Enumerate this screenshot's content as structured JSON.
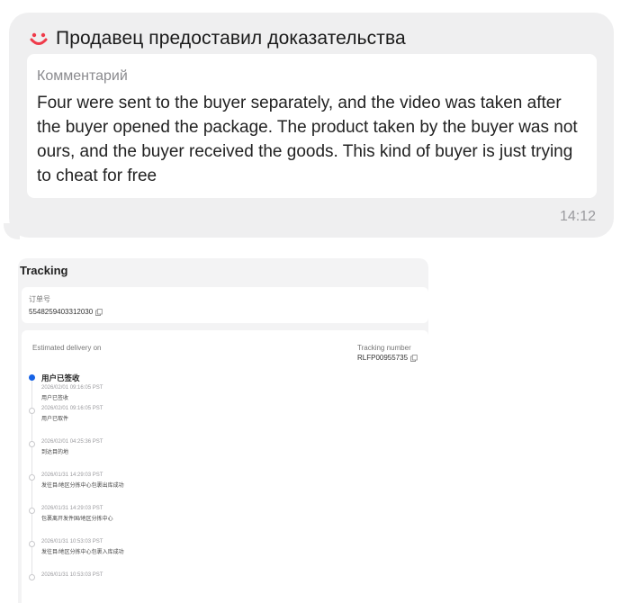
{
  "chat": {
    "title": "Продавец предоставил доказательства",
    "comment_label": "Комментарий",
    "comment_text": "Four were sent to the buyer separately, and the video was taken after the buyer opened the package. The product taken by the buyer was not ours, and the buyer received the goods. This kind of buyer is just trying to cheat for free",
    "time": "14:12",
    "accent_color": "#ef3b4a"
  },
  "tracking": {
    "title": "Tracking",
    "order_label": "订单号",
    "order_number": "5548259403312030",
    "estimated_delivery_label": "Estimated delivery on",
    "tracking_number_label": "Tracking number",
    "tracking_number": "RLFP00955735",
    "active_color": "#1763e6",
    "events": [
      {
        "headline": "用户已签收",
        "time": "2026/02/01 09:16:05 PST",
        "desc": "用户已签收"
      },
      {
        "headline": "",
        "time": "2026/02/01 09:16:05 PST",
        "desc": "用户已取件"
      },
      {
        "headline": "",
        "time": "2026/02/01 04:25:36 PST",
        "desc": "到达目的地"
      },
      {
        "headline": "",
        "time": "2026/01/31 14:29:03 PST",
        "desc": "发往目/地区分拣中心包裹出库成功"
      },
      {
        "headline": "",
        "time": "2026/01/31 14:29:03 PST",
        "desc": "包裹离开发件国/地区分拣中心"
      },
      {
        "headline": "",
        "time": "2026/01/31 10:53:03 PST",
        "desc": "发往目/地区分拣中心包裹入库成功"
      },
      {
        "headline": "",
        "time": "2026/01/31 10:53:03 PST",
        "desc": ""
      }
    ]
  }
}
